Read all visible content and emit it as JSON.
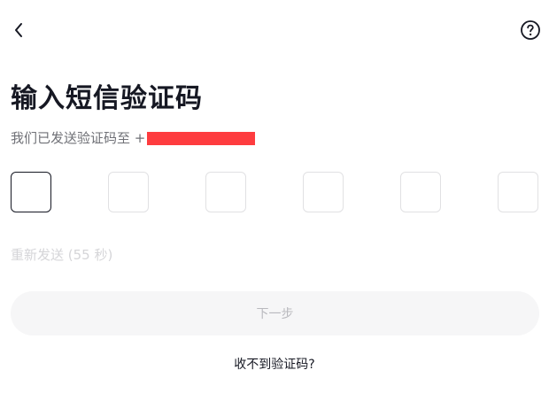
{
  "header": {
    "back_icon": "chevron-left-icon",
    "help_icon": "question-circle-icon"
  },
  "title": "输入短信验证码",
  "subtitle": {
    "prefix": "我们已发送验证码至 +"
  },
  "code_inputs": [
    "",
    "",
    "",
    "",
    "",
    ""
  ],
  "resend_text": "重新发送 (55 秒)",
  "next_button": "下一步",
  "no_code_link": "收不到验证码?",
  "colors": {
    "redaction": "#fe3c3f",
    "disabled_text": "#b9b9be",
    "button_bg": "#f6f6f7"
  }
}
